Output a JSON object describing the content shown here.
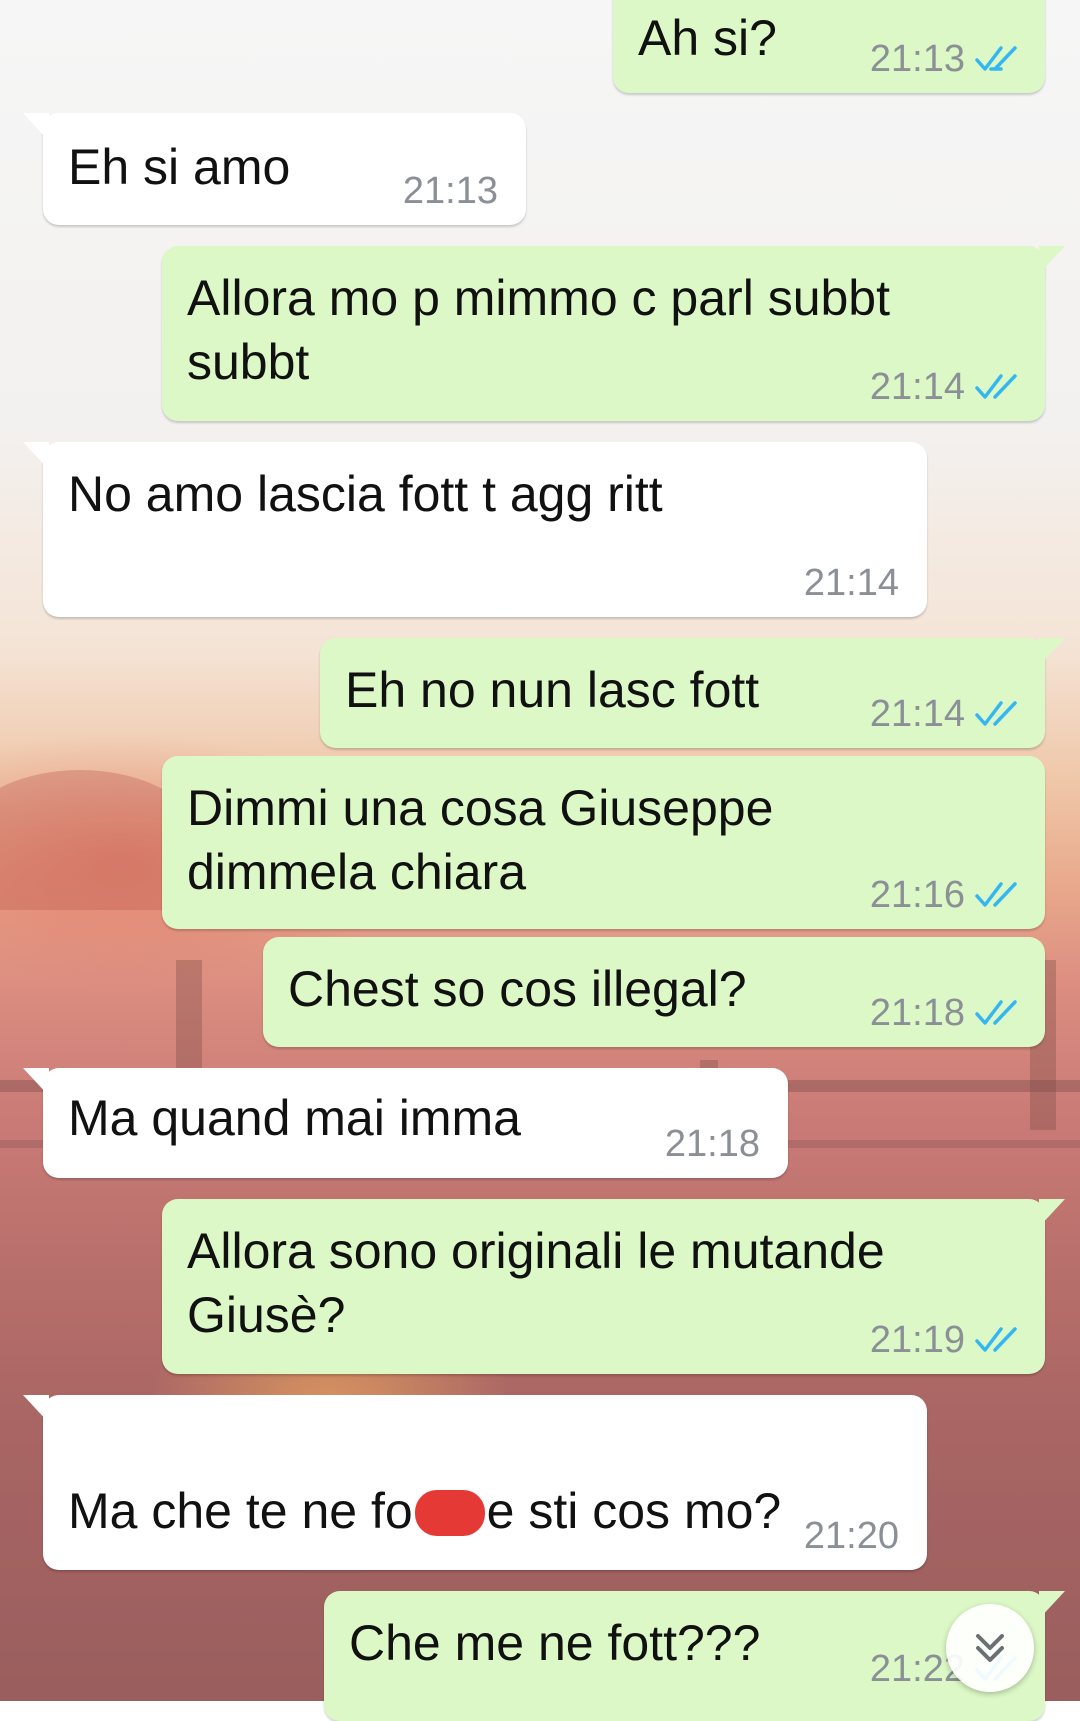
{
  "colors": {
    "incoming_bubble": "#ffffff",
    "outgoing_bubble": "#dcf8c6",
    "read_ticks": "#34b7f1",
    "time_text": "#8b9096",
    "redaction": "#e53935"
  },
  "icons": {
    "read_receipt": "double-check-icon",
    "scroll_down": "chevron-double-down-icon"
  },
  "messages": [
    {
      "dir": "out",
      "text": "Ah si?",
      "time": "21:13",
      "status": "read"
    },
    {
      "dir": "in",
      "text": "Eh si amo",
      "time": "21:13"
    },
    {
      "dir": "out",
      "text": "Allora mo p mimmo c parl subbt\nsubbt",
      "time": "21:14",
      "status": "read"
    },
    {
      "dir": "in",
      "text": "No amo lascia fott t agg ritt",
      "time": "21:14"
    },
    {
      "dir": "out",
      "text": "Eh no nun lasc fott",
      "time": "21:14",
      "status": "read"
    },
    {
      "dir": "out",
      "text": "Dimmi una cosa Giuseppe\ndimmela chiara",
      "time": "21:16",
      "status": "read"
    },
    {
      "dir": "out",
      "text": "Chest so cos illegal?",
      "time": "21:18",
      "status": "read"
    },
    {
      "dir": "in",
      "text": "Ma quand mai imma",
      "time": "21:18"
    },
    {
      "dir": "out",
      "text": "Allora sono originali le mutande\nGiusè?",
      "time": "21:19",
      "status": "read"
    },
    {
      "dir": "in",
      "text_before": "Ma che te ne fo",
      "text_after": "e sti cos mo?",
      "time": "21:20"
    },
    {
      "dir": "out",
      "text": "Che me ne fott???",
      "time": "21:22",
      "status": "read"
    }
  ]
}
